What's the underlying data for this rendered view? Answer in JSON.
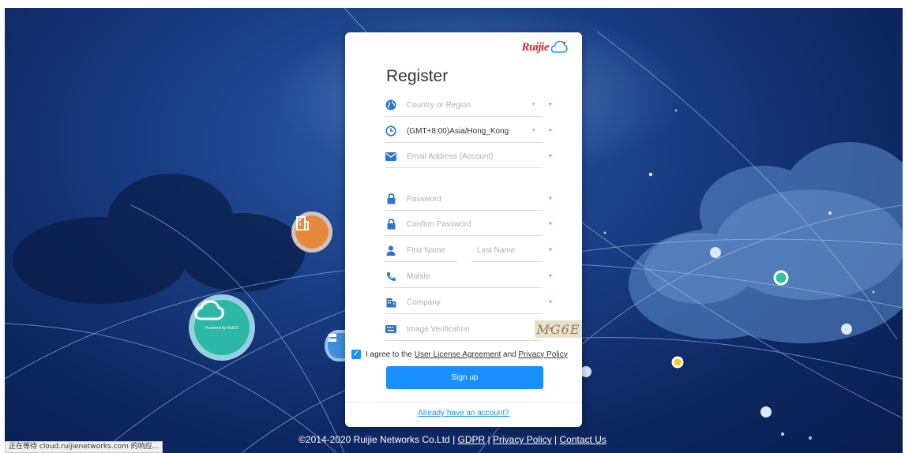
{
  "brand": {
    "logo_text": "Ruijie",
    "logo_sub": "Powered by RuCC",
    "badge_text": "Powered by RuiCC"
  },
  "register": {
    "title": "Register",
    "fields": {
      "country": {
        "placeholder": "Country or Region",
        "icon": "globe-icon"
      },
      "timezone": {
        "value": "(GMT+8:00)Asia/Hong_Kong",
        "icon": "clock-icon"
      },
      "email": {
        "placeholder": "Email Address (Account)",
        "icon": "envelope-icon"
      },
      "password": {
        "placeholder": "Password",
        "icon": "lock-icon"
      },
      "confirm_password": {
        "placeholder": "Confirm Password",
        "icon": "lock-icon"
      },
      "first_name": {
        "placeholder": "First Name",
        "icon": "user-icon"
      },
      "last_name": {
        "placeholder": "Last Name"
      },
      "mobile": {
        "placeholder": "Mobile",
        "icon": "phone-icon"
      },
      "company": {
        "placeholder": "Company",
        "icon": "building-icon"
      },
      "verification": {
        "placeholder": "Image Verification",
        "captcha": "MG6E",
        "icon": "keyboard-icon"
      }
    },
    "required_mark": "*",
    "agree": {
      "checked": true,
      "prefix": "I agree to the",
      "license_link": "User License Agreement",
      "and": "and",
      "privacy_link": "Privacy Policy"
    },
    "signup_label": "Sign up",
    "have_account": "Already have an account?"
  },
  "footer": {
    "copyright": "©2014-2020 Ruijie Networks Co.Ltd",
    "sep": "|",
    "gdpr": "GDPR",
    "privacy": "Privacy Policy",
    "contact": "Contact Us"
  },
  "statusbar": {
    "text": "正在等待 cloud.ruijienetworks.com 的响应..."
  },
  "colors": {
    "accent": "#1890ff",
    "required": "#e43b3b",
    "brand_red": "#d8262e",
    "bg_dark": "#0e2762"
  }
}
